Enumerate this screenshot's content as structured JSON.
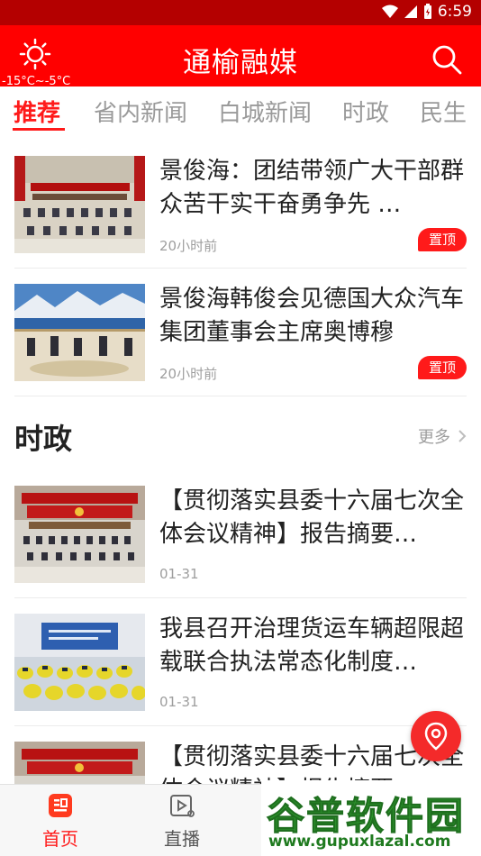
{
  "status_bar": {
    "time": "6:59"
  },
  "header": {
    "title": "通榆融媒",
    "weather_temp": "-15°C~-5°C"
  },
  "tabs": [
    {
      "label": "推荐",
      "active": true
    },
    {
      "label": "省内新闻",
      "active": false
    },
    {
      "label": "白城新闻",
      "active": false
    },
    {
      "label": "时政",
      "active": false
    },
    {
      "label": "民生",
      "active": false
    }
  ],
  "featured": [
    {
      "title": "景俊海：团结带领广大干部群众苦干实干奋勇争先 …",
      "time": "20小时前",
      "badge": "置顶"
    },
    {
      "title": "景俊海韩俊会见德国大众汽车集团董事会主席奥博穆",
      "time": "20小时前",
      "badge": "置顶"
    }
  ],
  "section": {
    "title": "时政",
    "more": "更多"
  },
  "section_news": [
    {
      "title": "【贯彻落实县委十六届七次全体会议精神】报告摘要…",
      "time": "01-31"
    },
    {
      "title": "我县召开治理货运车辆超限超载联合执法常态化制度…",
      "time": "01-31"
    },
    {
      "title": "【贯彻落实县委十六届七次全体会议精神】报告摘要…",
      "time": ""
    }
  ],
  "bottom_nav": [
    {
      "label": "首页",
      "icon": "home-news-icon",
      "active": true
    },
    {
      "label": "直播",
      "icon": "live-play-icon",
      "active": false
    }
  ],
  "watermark": {
    "brand": "谷普软件园",
    "url": "www.gupuxlazal.com"
  },
  "colors": {
    "primary": "#ff0000",
    "status_bar": "#b40000",
    "accent": "#ff1a1a"
  }
}
